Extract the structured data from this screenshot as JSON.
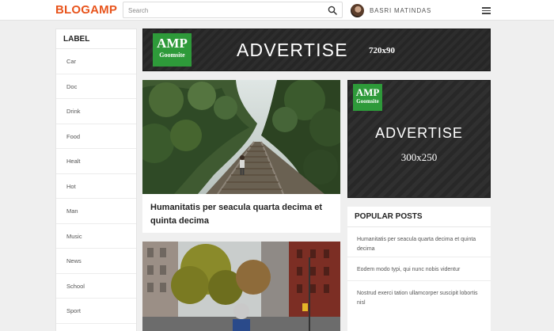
{
  "header": {
    "logo": "BLOGAMP",
    "search_placeholder": "Search",
    "user_name": "BASRI MATINDAS"
  },
  "sidebar": {
    "title": "LABEL",
    "labels": [
      "Car",
      "Doc",
      "Drink",
      "Food",
      "Healt",
      "Hot",
      "Man",
      "Music",
      "News",
      "School",
      "Sport"
    ]
  },
  "ads": {
    "banner": {
      "badge_top": "AMP",
      "badge_bottom": "Goomsite",
      "title": "ADVERTISE",
      "size": "720x90"
    },
    "rect": {
      "badge_top": "AMP",
      "badge_bottom": "Goomsite",
      "title": "ADVERTISE",
      "size": "300x250"
    }
  },
  "posts": [
    {
      "title": "Humanitatis per seacula quarta decima et quinta decima"
    }
  ],
  "popular": {
    "title": "POPULAR POSTS",
    "items": [
      "Humanitatis per seacula quarta decima et quinta decima",
      "Eodem modo typi, qui nunc nobis videntur",
      "Nostrud exerci tation ullamcorper suscipit lobortis nisl"
    ]
  },
  "colors": {
    "brand": "#e8541c",
    "amp_green": "#2e9a3a",
    "ad_bg": "#2a2a2a"
  }
}
